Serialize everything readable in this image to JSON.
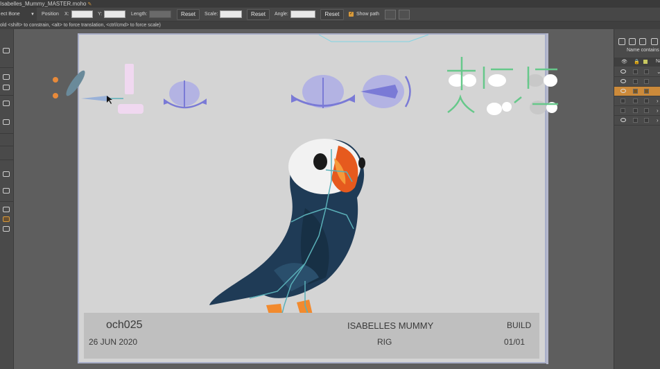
{
  "window": {
    "title": "Isabelles_Mummy_MASTER.moho"
  },
  "toolbar": {
    "bone_select": "ect Bone",
    "position_label": "Position",
    "x_label": "X:",
    "y_label": "Y:",
    "length_label": "Length:",
    "reset_1": "Reset",
    "scale_label": "Scale:",
    "reset_2": "Reset",
    "angle_label": "Angle:",
    "reset_3": "Reset",
    "show_path_label": "Show path"
  },
  "hint": "old <shift> to constrain, <alt> to force translation, <ctrl/cmd> to force scale)",
  "layers_panel": {
    "name_label": "Name contains",
    "header_label": "Na",
    "selected_row_index": 2
  },
  "slate": {
    "shot": "och025",
    "date": "26 JUN 2020",
    "project": "ISABELLES MUMMY",
    "department": "RIG",
    "stage": "BUILD",
    "page": "01/01"
  },
  "colors": {
    "accent": "#d89a3b",
    "canvas_bg": "#d4d4d4",
    "slate_bg": "#bfbfbf",
    "bone": "#5ab0b8",
    "control_purple": "#7a7ad6",
    "control_green": "#66c88a",
    "puffin_body": "#1f3b56"
  }
}
